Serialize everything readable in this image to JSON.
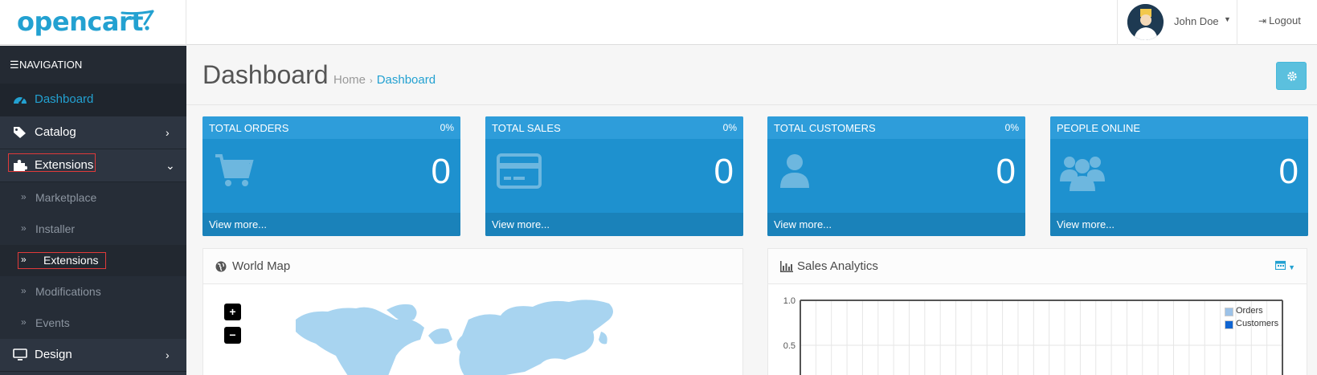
{
  "header": {
    "brand": "opencart",
    "user_name": "John Doe",
    "logout_label": "Logout"
  },
  "sidebar": {
    "heading": "NAVIGATION",
    "items": [
      {
        "label": "Dashboard",
        "icon": "dashboard-icon",
        "state": "active"
      },
      {
        "label": "Catalog",
        "icon": "tags-icon",
        "has_children": true
      },
      {
        "label": "Extensions",
        "icon": "puzzle-icon",
        "has_children": true,
        "expanded": true
      },
      {
        "label": "Design",
        "icon": "monitor-icon",
        "has_children": true
      }
    ],
    "extensions_children": [
      {
        "label": "Marketplace"
      },
      {
        "label": "Installer"
      },
      {
        "label": "Extensions",
        "current": true
      },
      {
        "label": "Modifications"
      },
      {
        "label": "Events"
      }
    ]
  },
  "page": {
    "title": "Dashboard",
    "breadcrumb": [
      {
        "label": "Home"
      },
      {
        "label": "Dashboard",
        "current": true
      }
    ]
  },
  "tiles": [
    {
      "title": "TOTAL ORDERS",
      "percent": "0%",
      "value": "0",
      "link": "View more...",
      "icon": "shopping-cart-icon"
    },
    {
      "title": "TOTAL SALES",
      "percent": "0%",
      "value": "0",
      "link": "View more...",
      "icon": "credit-card-icon"
    },
    {
      "title": "TOTAL CUSTOMERS",
      "percent": "0%",
      "value": "0",
      "link": "View more...",
      "icon": "user-icon"
    },
    {
      "title": "PEOPLE ONLINE",
      "percent": "",
      "value": "0",
      "link": "View more...",
      "icon": "users-icon"
    }
  ],
  "world_map": {
    "title": "World Map",
    "zoom_in": "+",
    "zoom_out": "−"
  },
  "sales_analytics": {
    "title": "Sales Analytics",
    "y_ticks": [
      "1.0",
      "0.5"
    ],
    "legend": [
      {
        "name": "Orders",
        "color": "#9cc2e8"
      },
      {
        "name": "Customers",
        "color": "#1065d2"
      }
    ]
  },
  "colors": {
    "accent": "#23a1d1",
    "tile_blue": "#1e91cf",
    "sidebar_bg": "#2d3541",
    "highlight_box": "#e03a3a"
  }
}
